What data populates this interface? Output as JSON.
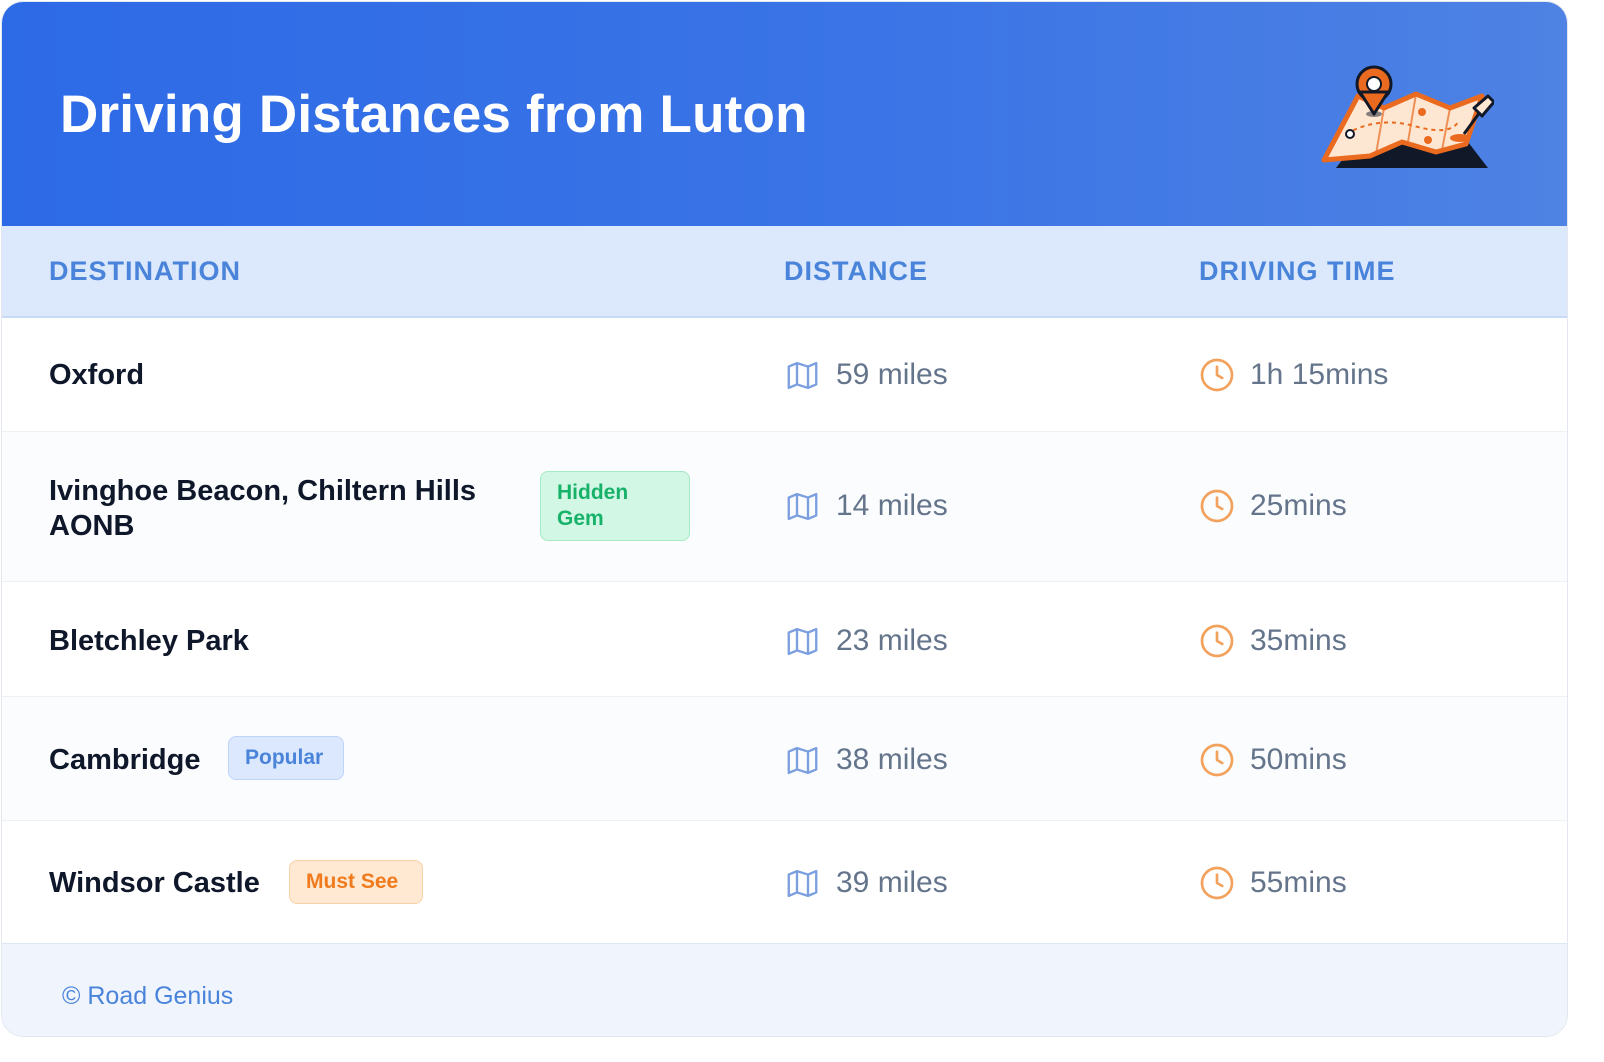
{
  "header": {
    "title": "Driving Distances from Luton"
  },
  "table": {
    "columns": [
      "DESTINATION",
      "DISTANCE",
      "DRIVING TIME"
    ],
    "rows": [
      {
        "destination": "Oxford",
        "badge": "",
        "distance": "59 miles",
        "time": "1h 15mins"
      },
      {
        "destination": "Ivinghoe Beacon, Chiltern Hills AONB",
        "badge": "Hidden Gem",
        "distance": "14 miles",
        "time": "25mins"
      },
      {
        "destination": "Bletchley Park",
        "badge": "",
        "distance": "23 miles",
        "time": "35mins"
      },
      {
        "destination": "Cambridge",
        "badge": "Popular",
        "distance": "38 miles",
        "time": "50mins"
      },
      {
        "destination": "Windsor Castle",
        "badge": "Must See",
        "distance": "39 miles",
        "time": "55mins"
      }
    ]
  },
  "footer": {
    "credit": "© Road Genius"
  },
  "icons": {
    "distance": "map-icon",
    "time": "clock-icon",
    "header": "map-pin-illustration"
  },
  "colors": {
    "header_blue": "#2d6ae6",
    "accent_blue": "#4a84da",
    "orange": "#f07a1c",
    "green": "#17b26a"
  }
}
